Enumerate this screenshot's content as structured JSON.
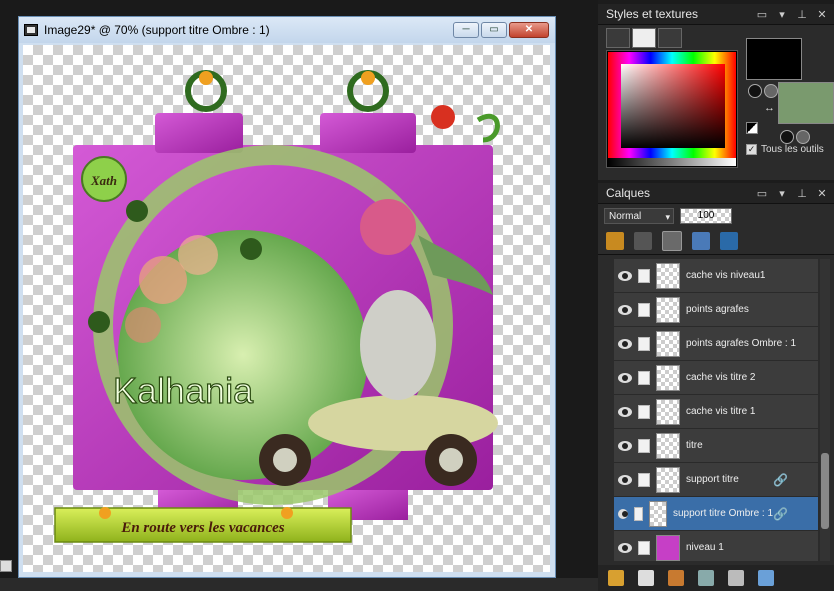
{
  "document": {
    "title": "Image29* @  70% (support titre Ombre : 1)",
    "buttons": [
      "─",
      "▭",
      "✕"
    ]
  },
  "canvas_art": {
    "signature": "Kalhania",
    "badge_text": "Xath",
    "banner_text": "En route vers les vacances"
  },
  "styles_panel": {
    "title": "Styles et textures",
    "all_tools_label": "Tous les outils",
    "all_tools_checked": true,
    "foreground_color": "#000000",
    "background_color": "#7a9a6e"
  },
  "layers_panel": {
    "title": "Calques",
    "blend_mode": "Normal",
    "opacity": "100",
    "layers": [
      {
        "name": "cache vis niveau1",
        "linked": false,
        "selected": false
      },
      {
        "name": "points agrafes",
        "linked": false,
        "selected": false
      },
      {
        "name": "points agrafes Ombre : 1",
        "linked": false,
        "selected": false
      },
      {
        "name": "cache vis titre 2",
        "linked": false,
        "selected": false
      },
      {
        "name": "cache vis titre 1",
        "linked": false,
        "selected": false
      },
      {
        "name": "titre",
        "linked": false,
        "selected": false
      },
      {
        "name": "support titre",
        "linked": true,
        "selected": false
      },
      {
        "name": "support titre Ombre : 1",
        "linked": true,
        "selected": true
      },
      {
        "name": "niveau 1",
        "linked": false,
        "selected": false,
        "thumb": "magenta"
      }
    ]
  }
}
